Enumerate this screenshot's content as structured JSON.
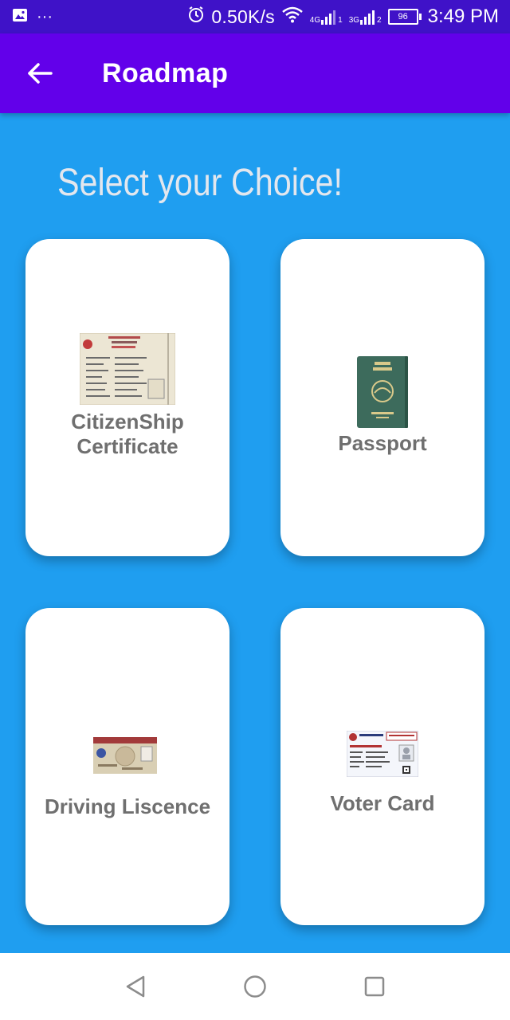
{
  "status_bar": {
    "net_speed": "0.50K/s",
    "net_4g": "4G",
    "net_3g": "3G",
    "sim1": "1",
    "sim2": "2",
    "battery": "96",
    "time": "3:49 PM",
    "overflow": "···"
  },
  "app_bar": {
    "title": "Roadmap"
  },
  "heading": "Select your Choice!",
  "cards": [
    {
      "label_line1": "CitizenShip",
      "label_line2": "Certificate"
    },
    {
      "label": "Passport"
    },
    {
      "label": "Driving Liscence"
    },
    {
      "label": "Voter Card"
    }
  ],
  "colors": {
    "status_bar": "#3f12c8",
    "app_bar": "#6200ea",
    "background": "#1f9ef0",
    "card": "#ffffff",
    "card_text": "#6f6f6f"
  }
}
